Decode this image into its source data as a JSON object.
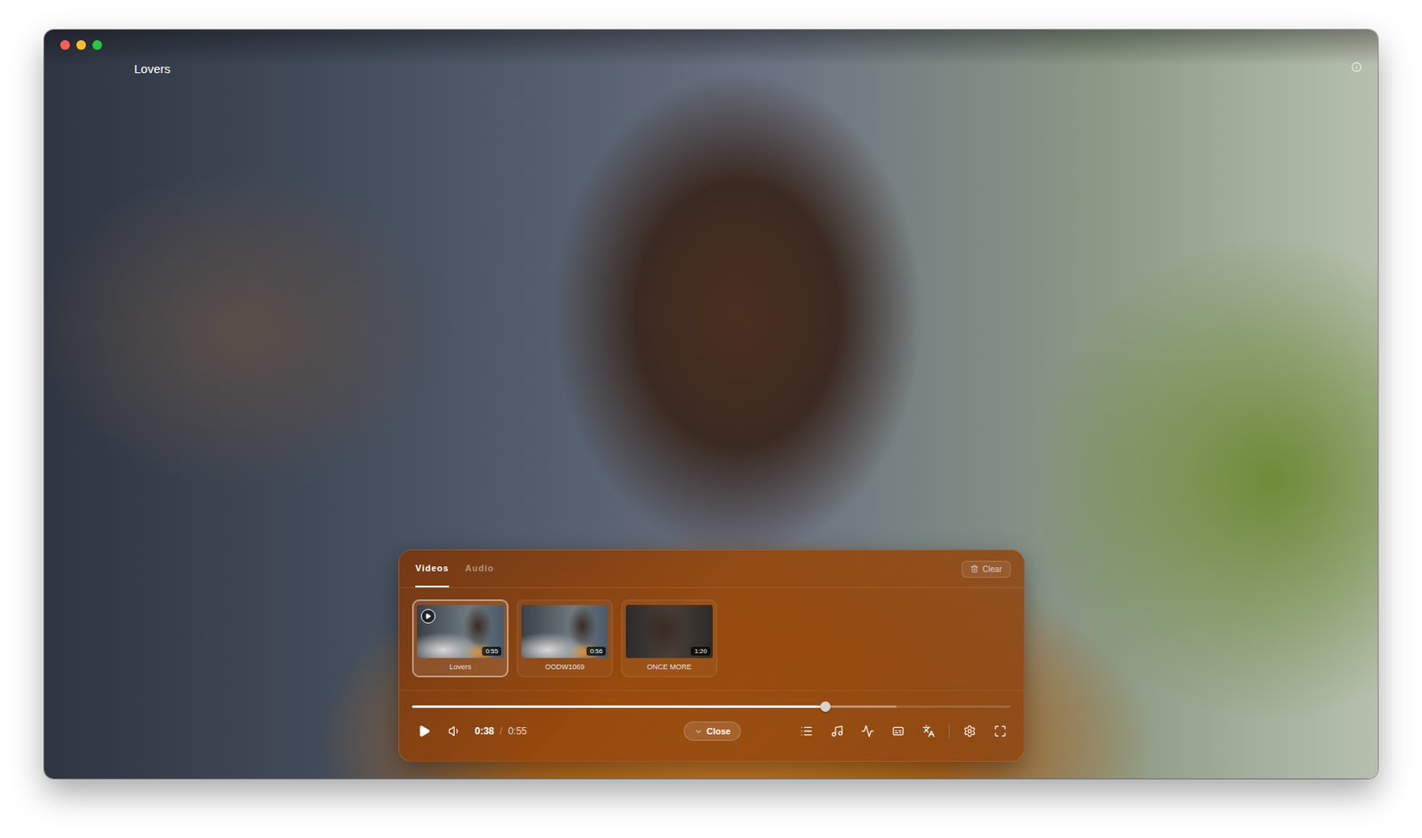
{
  "window": {
    "title": "Lovers"
  },
  "tabs": [
    {
      "label": "Videos",
      "selected": true
    },
    {
      "label": "Audio",
      "selected": false
    }
  ],
  "clear_button": "Clear",
  "playlist": [
    {
      "title": "Lovers",
      "duration": "0:55",
      "selected": true,
      "playing": true
    },
    {
      "title": "OODW1069",
      "duration": "0:56",
      "selected": false,
      "playing": false
    },
    {
      "title": "ONCE MORE",
      "duration": "1:20",
      "selected": false,
      "playing": false
    }
  ],
  "progress": {
    "level": 0.69,
    "buffered": 0.81
  },
  "time": {
    "current": "0:38",
    "separator": "/",
    "total": "0:55"
  },
  "close_button": "Close"
}
